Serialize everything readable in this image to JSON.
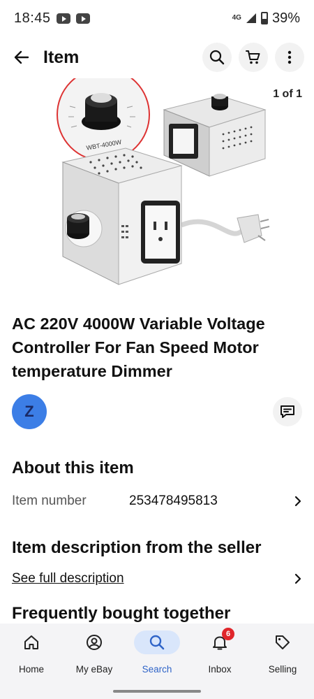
{
  "status_bar": {
    "time": "18:45",
    "network": "4G",
    "battery": "39%",
    "icons": [
      "youtube-icon",
      "youtube-icon",
      "signal-icon",
      "battery-icon"
    ]
  },
  "app_bar": {
    "title": "Item",
    "icons": [
      "back-arrow-icon",
      "search-icon",
      "cart-icon",
      "more-vertical-icon"
    ]
  },
  "gallery": {
    "counter": "1 of 1",
    "image_markings": "WBT-4000W"
  },
  "product": {
    "title": "AC 220V 4000W Variable Voltage Controller For Fan Speed Motor temperature Dimmer"
  },
  "seller": {
    "avatar_letter": "Z",
    "avatar_color": "#3c7ee6"
  },
  "about": {
    "heading": "About this item",
    "item_number_label": "Item number",
    "item_number_value": "253478495813"
  },
  "description": {
    "heading": "Item description from the seller",
    "link": "See full description"
  },
  "frequently_bought": {
    "heading": "Frequently bought together"
  },
  "bottom_nav": {
    "items": [
      {
        "label": "Home",
        "icon": "home-icon"
      },
      {
        "label": "My eBay",
        "icon": "user-icon"
      },
      {
        "label": "Search",
        "icon": "search-icon",
        "active": true
      },
      {
        "label": "Inbox",
        "icon": "bell-icon",
        "badge": "6"
      },
      {
        "label": "Selling",
        "icon": "tag-icon"
      }
    ],
    "active_color": "#2f64c8",
    "badge_color": "#e0262b"
  }
}
